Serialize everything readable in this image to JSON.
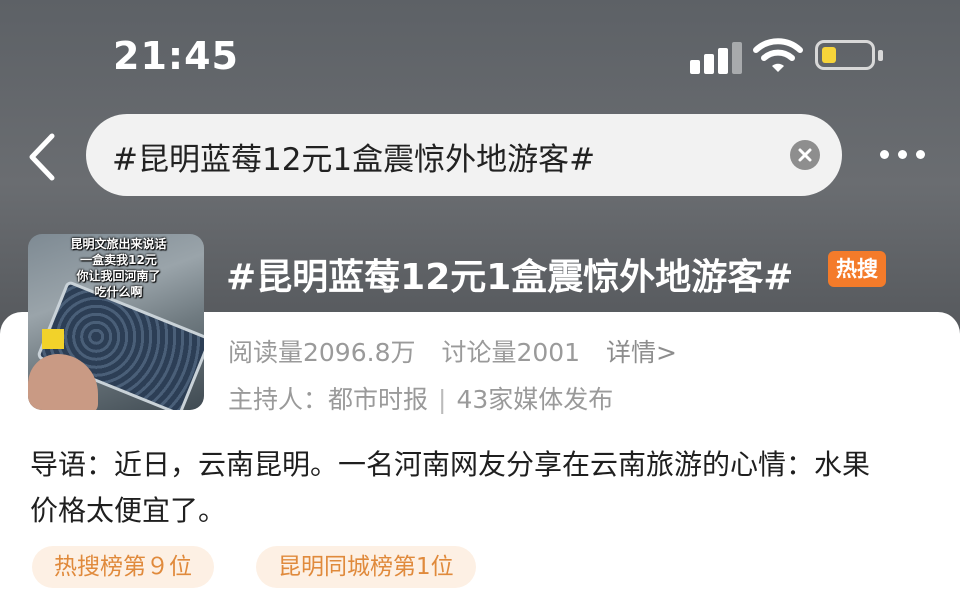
{
  "status_bar": {
    "time": "21:45",
    "battery_color": "#f7d43a"
  },
  "header": {
    "search_query": "#昆明蓝莓12元1盒震惊外地游客#",
    "back_icon": "chevron-left-icon",
    "clear_icon": "clear-circle-icon",
    "more_icon": "more-dots-icon"
  },
  "topic": {
    "title": "#昆明蓝莓12元1盒震惊外地游客#",
    "badge": "热搜",
    "badge_color": "#f47b2a",
    "thumbnail_caption": [
      "昆明文旅出来说话",
      "一盒卖我12元",
      "你让我回河南了",
      "吃什么啊"
    ],
    "reads_label": "阅读量2096.8万",
    "discussions_label": "讨论量2001",
    "detail_link": "详情>",
    "host_label": "主持人：都市时报",
    "media_label": "43家媒体发布",
    "intro": "导语：近日，云南昆明。一名河南网友分享在云南旅游的心情：水果价格太便宜了。",
    "rank_tags": [
      "热搜榜第９位",
      "昆明同城榜第1位"
    ],
    "rank_tag_color": "#e08a3c"
  }
}
